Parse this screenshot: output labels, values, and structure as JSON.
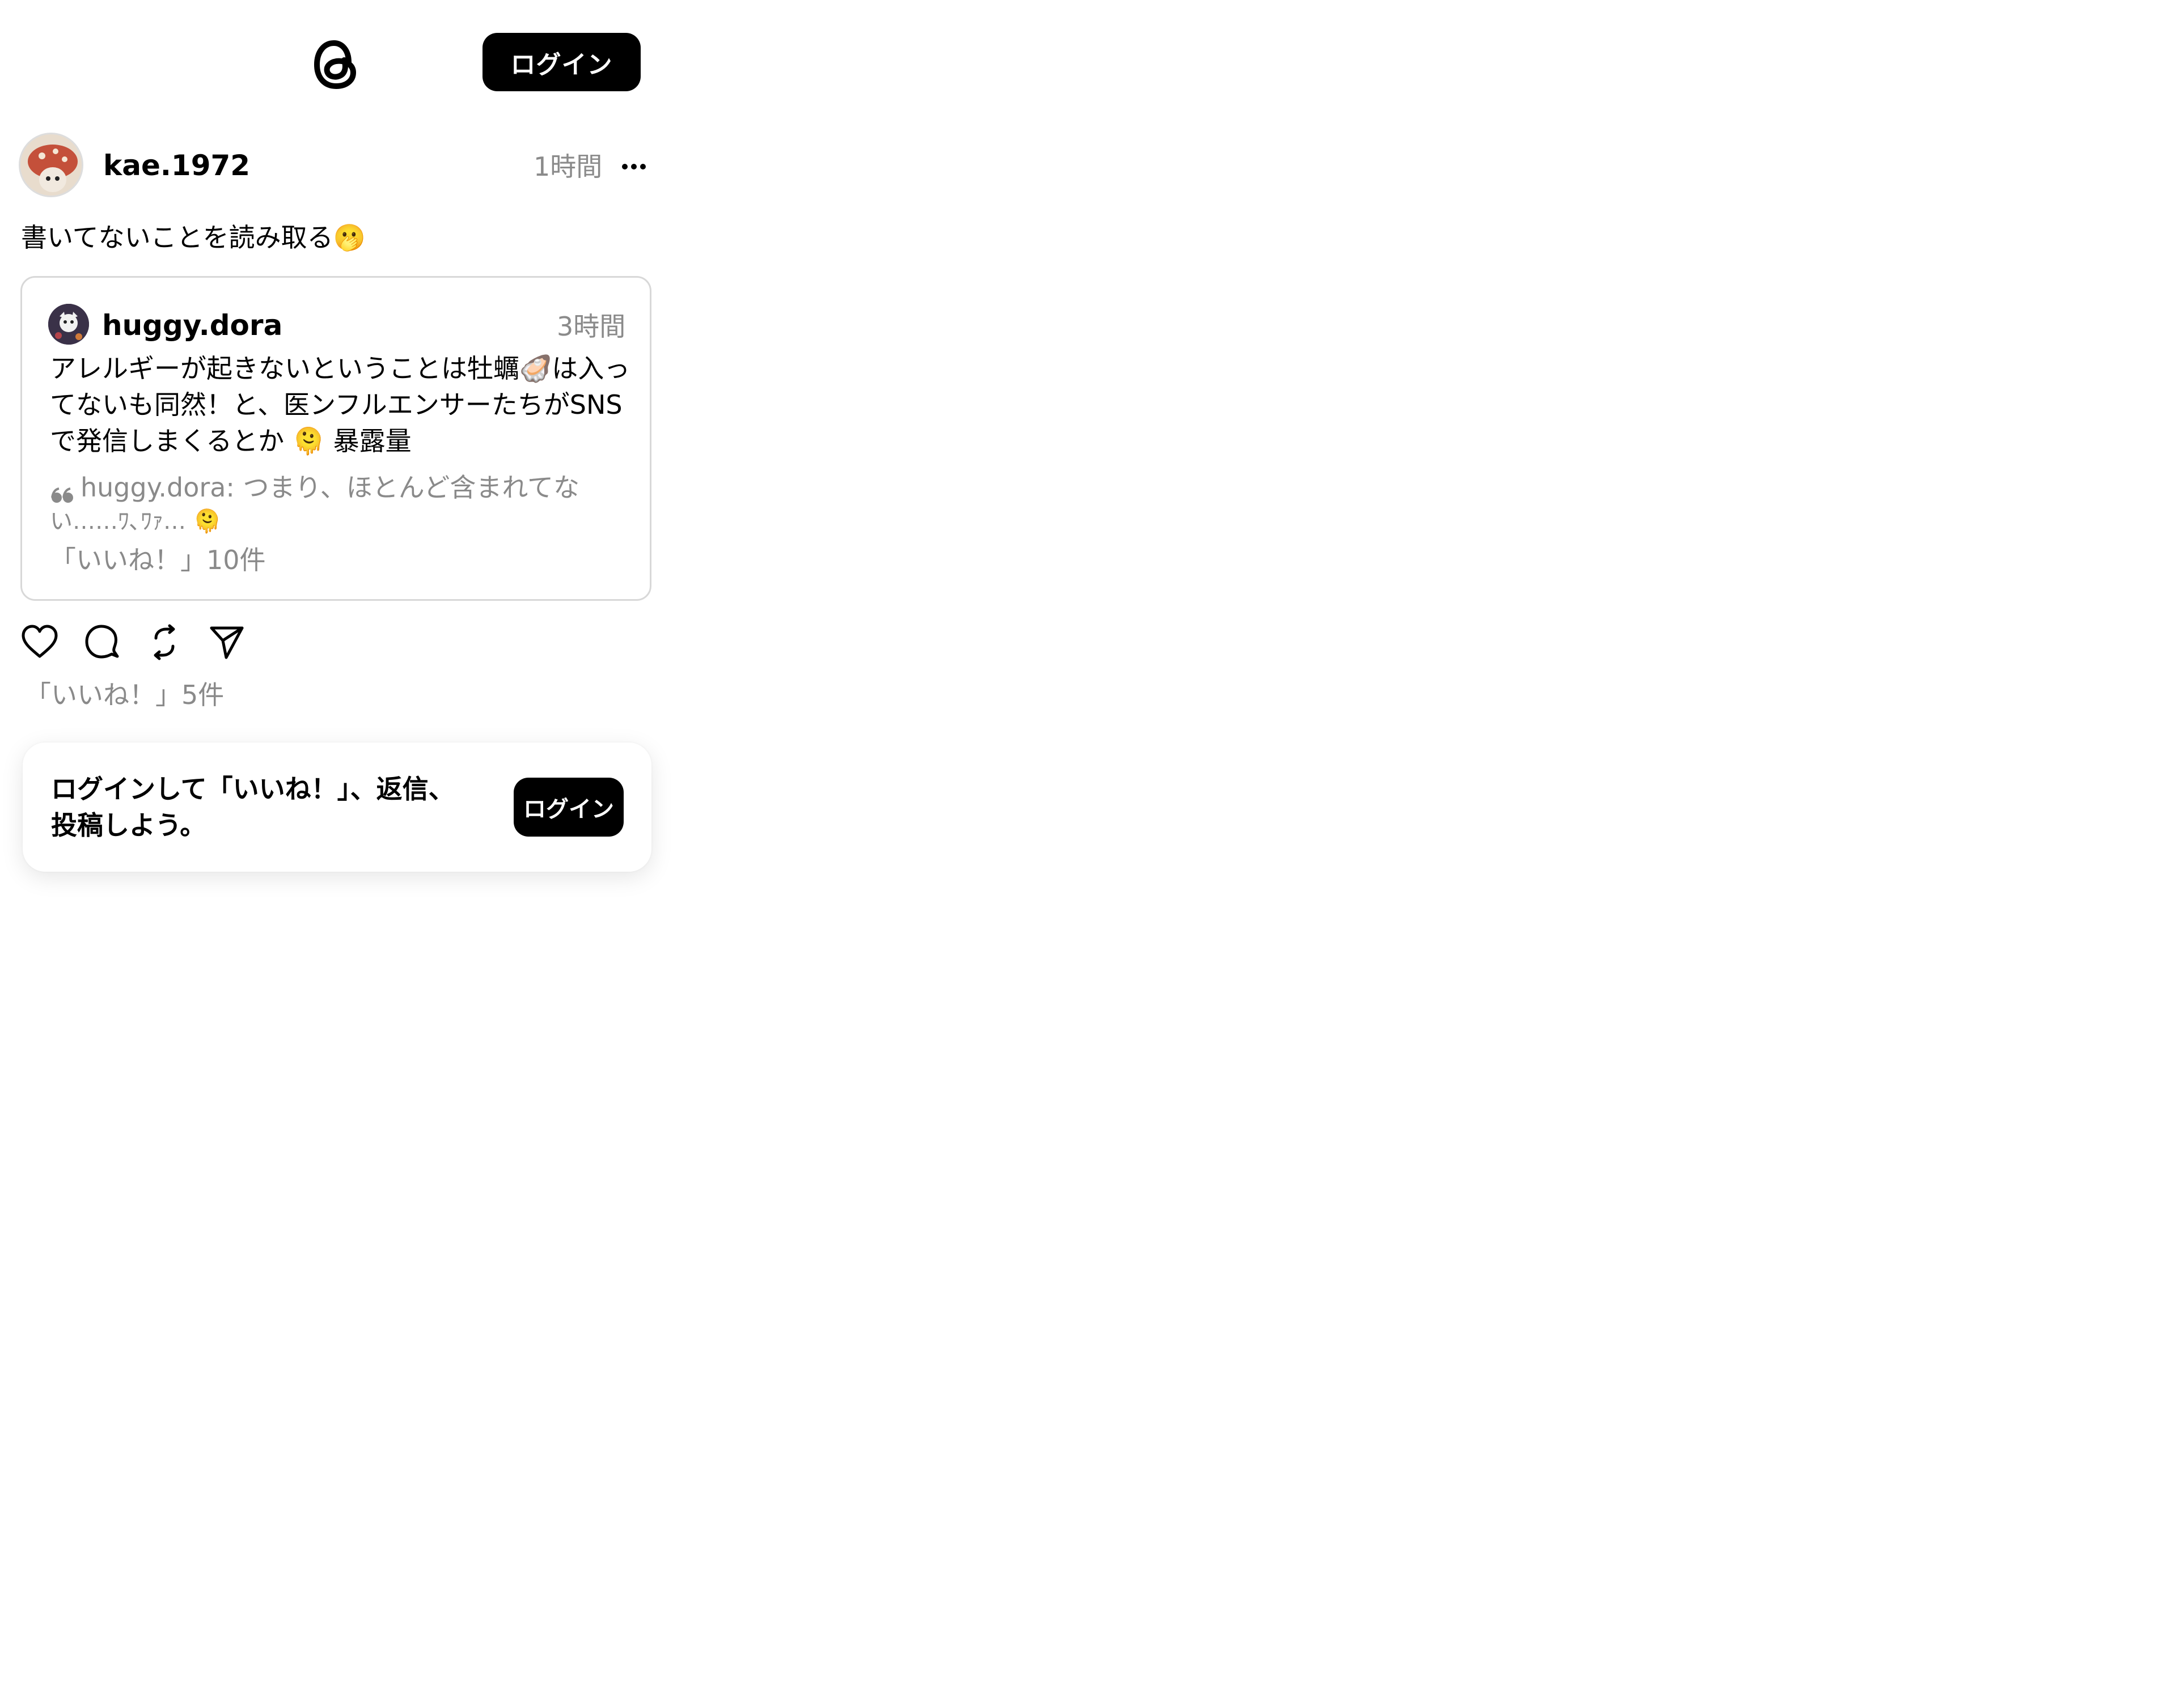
{
  "header": {
    "logo_icon": "threads-logo-icon",
    "login_label": "ログイン"
  },
  "post": {
    "username": "kae.1972",
    "time": "1時間",
    "more_icon": "more-horizontal-icon",
    "text": "書いてないことを読み取る🫢",
    "likes": "「いいね！」5件"
  },
  "quoted_post": {
    "username": "huggy.dora",
    "time": "3時間",
    "body_lines": [
      "アレルギーが起きないということは牡蠣🦪は入っ",
      "てないも同然！と、医ンフルエンサーたちがSNS",
      "で発信しまくるとか 🫠 暴露量"
    ],
    "quote_icon": "quote-mark-icon",
    "quote_line1": "huggy.dora: つまり、ほとんど含まれてな",
    "quote_line2": "い……ﾜ､ﾜｧ… 🫠",
    "likes": "「いいね！」10件"
  },
  "actions": [
    {
      "icon": "heart-icon"
    },
    {
      "icon": "reply-icon"
    },
    {
      "icon": "repost-icon"
    },
    {
      "icon": "share-icon"
    }
  ],
  "login_prompt": {
    "line1": "ログインして「いいね！」、返信、",
    "line2": "投稿しよう。",
    "button_label": "ログイン"
  },
  "colors": {
    "primary": "#000000",
    "secondary_text": "#8a8a8a",
    "border": "#d8d8d8",
    "background": "#ffffff"
  }
}
